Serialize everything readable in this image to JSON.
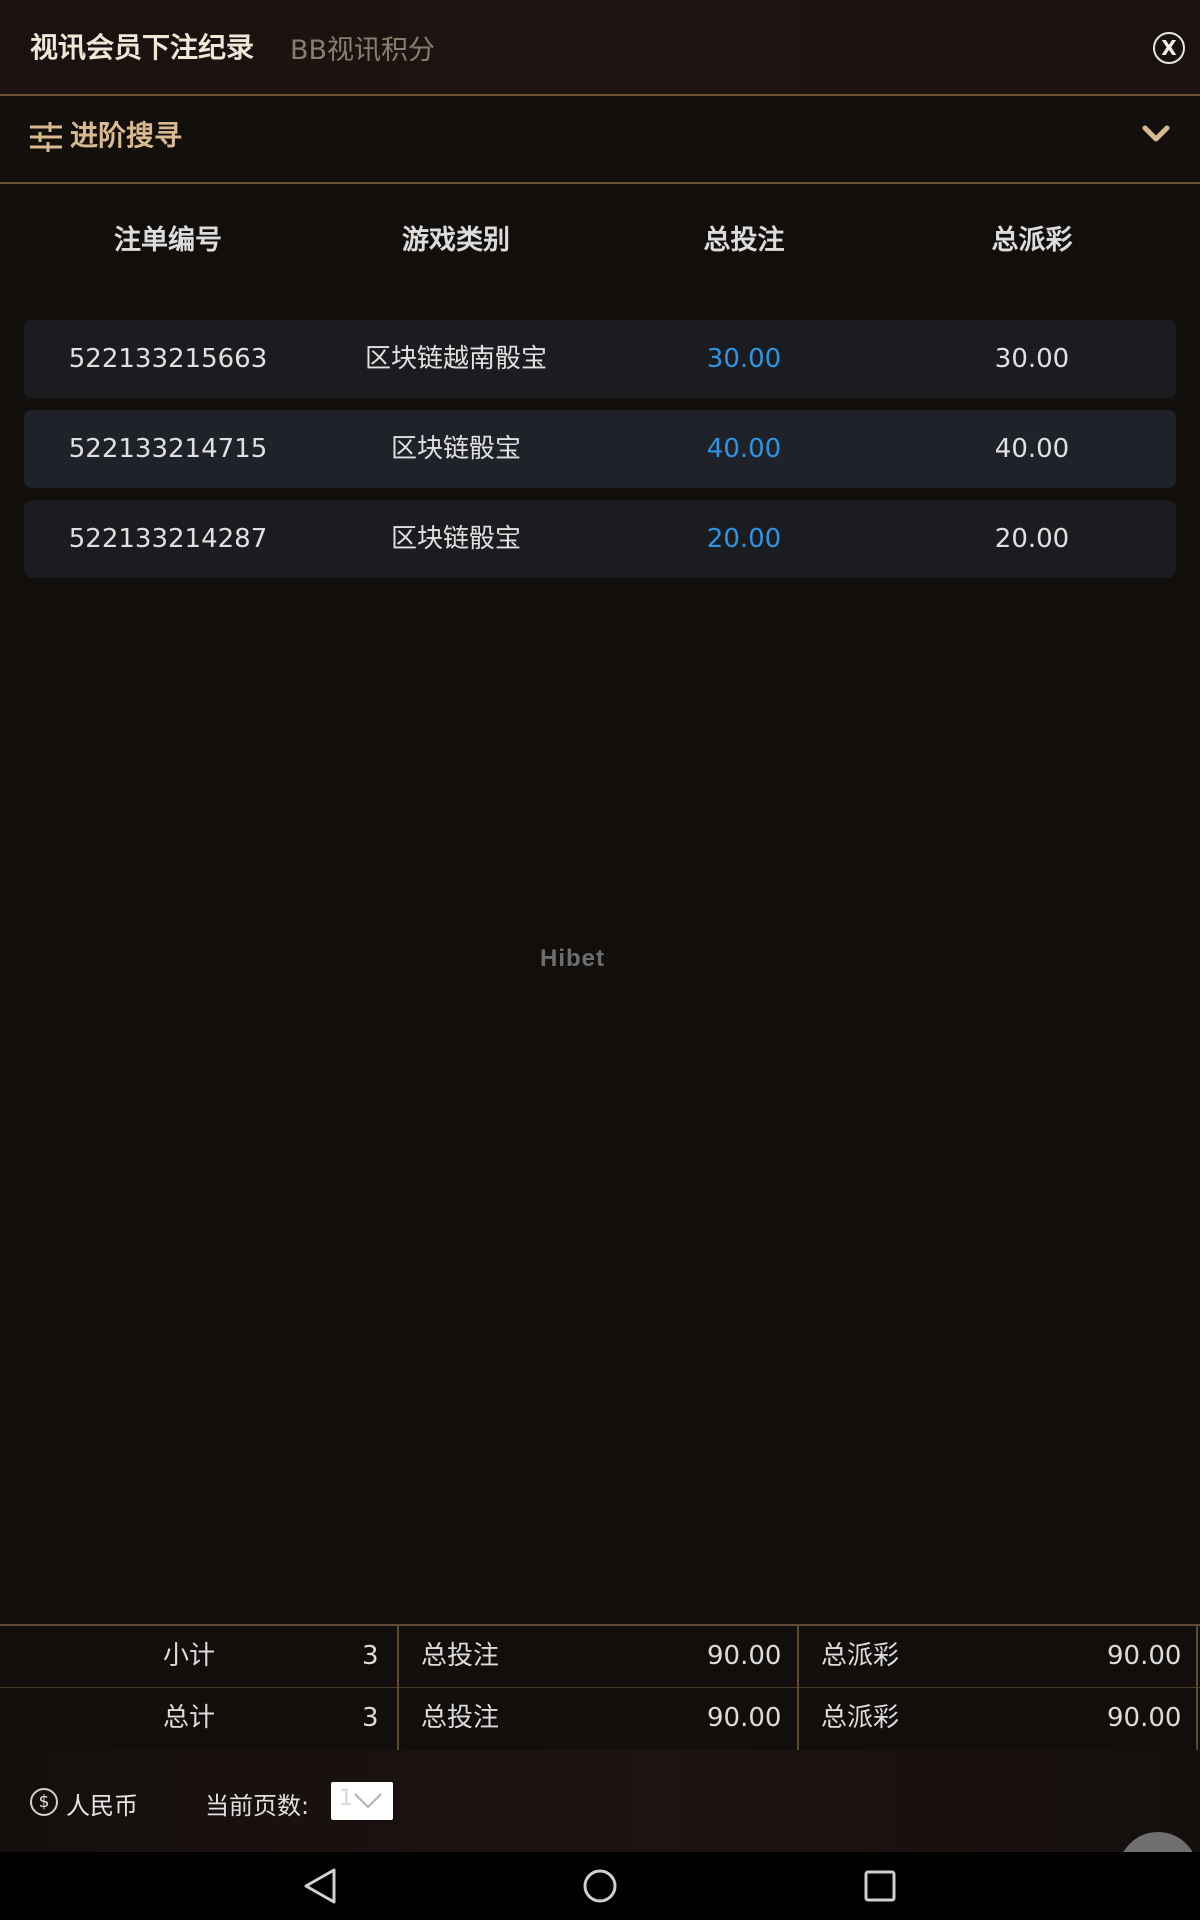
{
  "header": {
    "tab_active": "视讯会员下注纪录",
    "tab_inactive": "BB视讯积分",
    "close_label": "X"
  },
  "advanced_search": {
    "label": "进阶搜寻",
    "icon": "sliders-icon",
    "toggle_icon": "chevron-down-icon"
  },
  "table": {
    "headers": [
      "注单编号",
      "游戏类别",
      "总投注",
      "总派彩"
    ],
    "rows": [
      {
        "id": "522133215663",
        "game": "区块链越南骰宝",
        "bet": "30.00",
        "payout": "30.00"
      },
      {
        "id": "522133214715",
        "game": "区块链骰宝",
        "bet": "40.00",
        "payout": "40.00"
      },
      {
        "id": "522133214287",
        "game": "区块链骰宝",
        "bet": "20.00",
        "payout": "20.00"
      }
    ]
  },
  "watermark": "Hibet",
  "summary": {
    "subtotal": {
      "label": "小计",
      "count": "3",
      "bet_label": "总投注",
      "bet": "90.00",
      "payout_label": "总派彩",
      "payout": "90.00"
    },
    "total": {
      "label": "总计",
      "count": "3",
      "bet_label": "总投注",
      "bet": "90.00",
      "payout_label": "总派彩",
      "payout": "90.00"
    }
  },
  "footer": {
    "currency_icon": "$",
    "currency": "人民币",
    "page_label": "当前页数:",
    "page_value": "1"
  },
  "colors": {
    "accent_gold": "#d9b98f",
    "bet_blue": "#2e93e0",
    "background": "#120e0c"
  }
}
